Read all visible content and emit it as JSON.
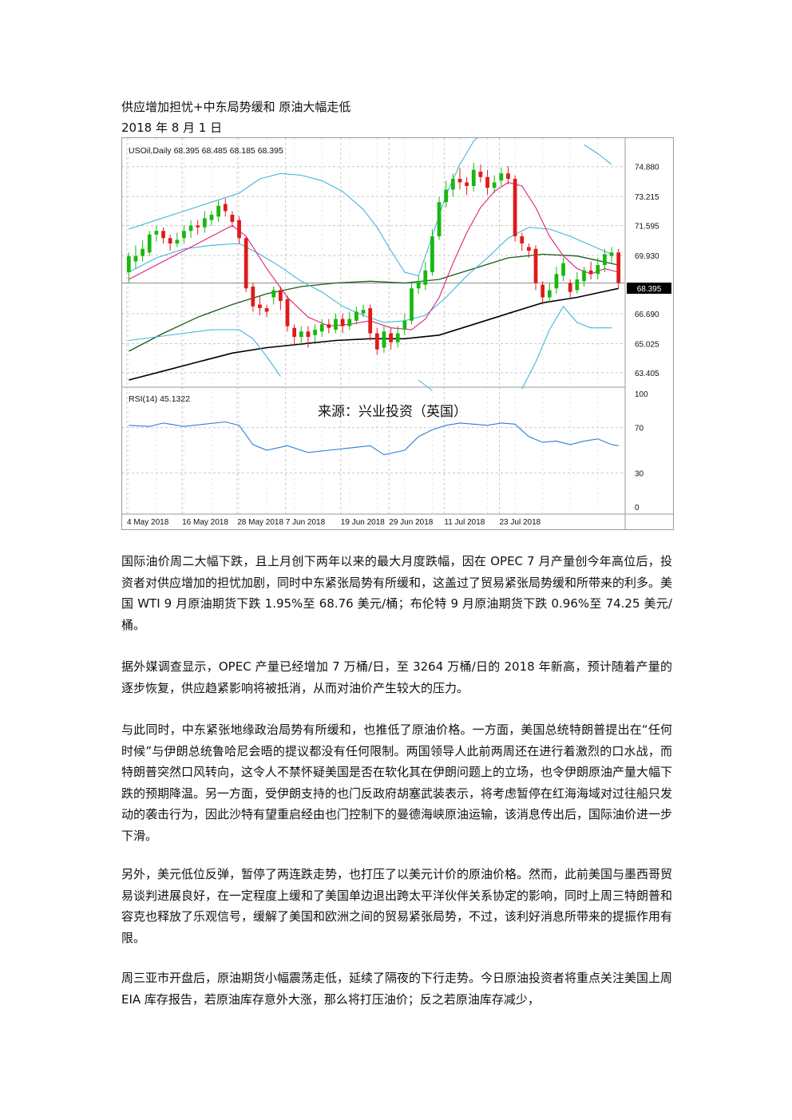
{
  "doc": {
    "title": "供应增加担忧+中东局势缓和  原油大幅走低",
    "date": "2018 年 8 月 1 日"
  },
  "chart": {
    "header": "USOil,Daily  68.395 68.485 68.185 68.395",
    "current_price_label": "68.395",
    "rsi_label": "RSI(14) 45.1322",
    "source_note": "来源：兴业投资（英国）",
    "price_ticks": [
      "74.880",
      "73.215",
      "71.595",
      "69.930",
      "66.690",
      "65.025",
      "63.405"
    ],
    "rsi_ticks": [
      "100",
      "70",
      "30",
      "0"
    ],
    "date_ticks": [
      "4 May 2018",
      "16 May 2018",
      "28 May 2018",
      "7 Jun 2018",
      "19 Jun 2018",
      "29 Jun 2018",
      "11 Jul 2018",
      "23 Jul 2018"
    ],
    "colors": {
      "up": "#18b80f",
      "down": "#e01a1a",
      "bollinger": "#3fb8d6",
      "ma_pink": "#e0207f",
      "ma_green": "#1c5a1c",
      "ma_black": "#000000",
      "rsi": "#2a7fd4"
    }
  },
  "chart_data": {
    "type": "candlestick",
    "title": "USOil,Daily",
    "price_range": [
      62.6,
      76.2
    ],
    "rsi_range": [
      0,
      100
    ],
    "rsi_last": 45.1322,
    "last_price": 68.395,
    "candles": [
      [
        69.0,
        69.9,
        70.1,
        68.4
      ],
      [
        69.6,
        69.9,
        70.5,
        69.2
      ],
      [
        69.9,
        70.3,
        70.8,
        69.6
      ],
      [
        70.1,
        71.1,
        71.3,
        69.9
      ],
      [
        71.1,
        71.3,
        71.6,
        70.7
      ],
      [
        71.3,
        70.9,
        71.5,
        70.6
      ],
      [
        70.9,
        70.6,
        71.1,
        70.2
      ],
      [
        70.6,
        70.8,
        71.2,
        70.4
      ],
      [
        70.9,
        71.3,
        71.6,
        70.6
      ],
      [
        71.3,
        71.6,
        71.9,
        70.9
      ],
      [
        71.6,
        71.5,
        71.9,
        71.1
      ],
      [
        71.5,
        72.0,
        72.4,
        71.2
      ],
      [
        71.9,
        72.2,
        72.4,
        71.6
      ],
      [
        72.1,
        72.7,
        73.0,
        71.8
      ],
      [
        72.8,
        72.4,
        73.1,
        72.1
      ],
      [
        72.2,
        71.8,
        72.4,
        71.5
      ],
      [
        71.9,
        70.9,
        72.1,
        70.6
      ],
      [
        70.9,
        68.1,
        71.0,
        67.9
      ],
      [
        68.2,
        67.1,
        68.4,
        66.8
      ],
      [
        67.2,
        67.0,
        67.7,
        66.6
      ],
      [
        67.0,
        66.8,
        67.2,
        66.5
      ],
      [
        67.6,
        68.0,
        68.2,
        67.2
      ],
      [
        68.0,
        67.4,
        68.2,
        66.9
      ],
      [
        67.5,
        66.0,
        67.7,
        65.7
      ],
      [
        65.9,
        65.4,
        66.1,
        64.9
      ],
      [
        65.4,
        65.7,
        66.0,
        64.9
      ],
      [
        65.7,
        65.4,
        66.0,
        64.8
      ],
      [
        65.5,
        65.8,
        66.1,
        65.1
      ],
      [
        65.7,
        66.1,
        66.4,
        65.4
      ],
      [
        66.1,
        65.9,
        66.4,
        65.6
      ],
      [
        65.8,
        66.4,
        66.7,
        65.6
      ],
      [
        66.4,
        66.0,
        66.7,
        65.6
      ],
      [
        66.0,
        66.4,
        66.8,
        65.8
      ],
      [
        66.3,
        66.8,
        67.1,
        66.1
      ],
      [
        66.7,
        66.9,
        67.2,
        66.5
      ],
      [
        67.0,
        65.6,
        67.2,
        65.2
      ],
      [
        65.6,
        64.7,
        65.9,
        64.4
      ],
      [
        64.8,
        65.7,
        66.0,
        64.5
      ],
      [
        65.6,
        65.1,
        65.9,
        64.7
      ],
      [
        65.1,
        65.6,
        66.0,
        64.8
      ],
      [
        65.8,
        66.3,
        66.7,
        65.5
      ],
      [
        66.3,
        68.1,
        68.4,
        66.1
      ],
      [
        68.1,
        68.5,
        68.8,
        67.8
      ],
      [
        68.3,
        69.1,
        69.6,
        68.0
      ],
      [
        69.0,
        71.0,
        71.4,
        68.8
      ],
      [
        71.0,
        72.9,
        73.2,
        70.8
      ],
      [
        72.9,
        73.6,
        74.1,
        72.6
      ],
      [
        73.6,
        74.2,
        74.5,
        73.2
      ],
      [
        74.2,
        74.0,
        74.8,
        73.6
      ],
      [
        74.0,
        73.8,
        74.3,
        73.3
      ],
      [
        73.8,
        74.7,
        75.1,
        73.5
      ],
      [
        74.6,
        74.3,
        75.0,
        74.0
      ],
      [
        74.3,
        73.7,
        74.7,
        73.3
      ],
      [
        73.7,
        74.0,
        74.4,
        73.4
      ],
      [
        74.1,
        74.5,
        74.8,
        73.8
      ],
      [
        74.5,
        74.2,
        74.9,
        73.9
      ],
      [
        74.2,
        71.0,
        74.4,
        70.7
      ],
      [
        71.0,
        70.6,
        71.2,
        70.2
      ],
      [
        70.4,
        70.2,
        70.6,
        69.8
      ],
      [
        70.3,
        68.4,
        70.5,
        68.0
      ],
      [
        68.3,
        67.6,
        68.5,
        67.2
      ],
      [
        67.6,
        68.0,
        68.4,
        67.3
      ],
      [
        68.1,
        68.9,
        69.3,
        67.8
      ],
      [
        68.8,
        69.5,
        69.8,
        68.5
      ],
      [
        68.4,
        67.9,
        68.6,
        67.6
      ],
      [
        68.0,
        68.6,
        69.0,
        67.8
      ],
      [
        68.5,
        69.1,
        69.3,
        68.2
      ],
      [
        69.1,
        68.9,
        69.6,
        68.6
      ],
      [
        68.9,
        69.4,
        69.8,
        68.6
      ],
      [
        69.4,
        70.0,
        70.3,
        69.0
      ],
      [
        69.9,
        70.1,
        70.4,
        69.5
      ],
      [
        70.1,
        68.4,
        70.3,
        68.1
      ]
    ],
    "bollinger_upper": [
      [
        0,
        71.4
      ],
      [
        4,
        71.9
      ],
      [
        8,
        72.4
      ],
      [
        12,
        72.9
      ],
      [
        16,
        73.4
      ],
      [
        19,
        74.2
      ],
      [
        22,
        74.5
      ],
      [
        25,
        74.4
      ],
      [
        28,
        74.1
      ],
      [
        31,
        73.5
      ],
      [
        34,
        72.5
      ],
      [
        36,
        71.5
      ],
      [
        38,
        70.2
      ],
      [
        40,
        69.0
      ],
      [
        42,
        68.8
      ],
      [
        44,
        71.0
      ],
      [
        46,
        73.3
      ],
      [
        48,
        75.0
      ],
      [
        50,
        76.3
      ],
      [
        52,
        77.0
      ]
    ],
    "bollinger_upper_tail": [
      [
        66,
        76.1
      ],
      [
        68,
        75.6
      ],
      [
        70,
        75.0
      ]
    ],
    "bollinger_middle": [
      [
        0,
        69.0
      ],
      [
        4,
        69.8
      ],
      [
        8,
        70.3
      ],
      [
        12,
        70.5
      ],
      [
        16,
        70.6
      ],
      [
        19,
        70.0
      ],
      [
        22,
        69.3
      ],
      [
        25,
        68.5
      ],
      [
        28,
        67.9
      ],
      [
        31,
        67.1
      ],
      [
        34,
        66.6
      ],
      [
        37,
        66.2
      ],
      [
        40,
        66.3
      ],
      [
        43,
        66.6
      ],
      [
        46,
        67.6
      ],
      [
        49,
        68.8
      ],
      [
        52,
        69.8
      ],
      [
        55,
        70.9
      ],
      [
        58,
        71.5
      ],
      [
        61,
        71.4
      ],
      [
        64,
        71.0
      ],
      [
        67,
        70.5
      ],
      [
        70,
        70.0
      ]
    ],
    "bollinger_lower": [
      [
        0,
        65.2
      ],
      [
        4,
        65.4
      ],
      [
        8,
        65.6
      ],
      [
        12,
        65.8
      ],
      [
        16,
        65.8
      ],
      [
        18,
        65.3
      ],
      [
        20,
        64.3
      ],
      [
        22,
        63.2
      ]
    ],
    "bollinger_lower_2": [
      [
        42,
        63.0
      ],
      [
        44,
        62.4
      ]
    ],
    "bollinger_lower_3": [
      [
        57,
        62.5
      ],
      [
        59,
        64.0
      ],
      [
        61,
        65.8
      ],
      [
        63,
        67.1
      ],
      [
        65,
        66.2
      ],
      [
        67,
        65.9
      ],
      [
        70,
        65.9
      ]
    ],
    "ma_pink": [
      [
        0,
        68.6
      ],
      [
        4,
        69.4
      ],
      [
        8,
        70.2
      ],
      [
        12,
        71.0
      ],
      [
        15,
        71.6
      ],
      [
        17,
        71.0
      ],
      [
        20,
        69.2
      ],
      [
        23,
        67.6
      ],
      [
        26,
        66.5
      ],
      [
        29,
        66.0
      ],
      [
        32,
        66.1
      ],
      [
        35,
        66.3
      ],
      [
        38,
        65.9
      ],
      [
        41,
        65.8
      ],
      [
        43,
        66.4
      ],
      [
        45,
        67.6
      ],
      [
        47,
        69.5
      ],
      [
        49,
        71.2
      ],
      [
        51,
        72.6
      ],
      [
        53,
        73.5
      ],
      [
        55,
        74.0
      ],
      [
        57,
        73.8
      ],
      [
        59,
        72.6
      ],
      [
        61,
        71.0
      ],
      [
        63,
        69.9
      ],
      [
        65,
        69.2
      ],
      [
        67,
        68.9
      ],
      [
        69,
        69.2
      ],
      [
        71,
        69.0
      ]
    ],
    "ma_green": [
      [
        0,
        64.6
      ],
      [
        5,
        65.6
      ],
      [
        10,
        66.5
      ],
      [
        15,
        67.2
      ],
      [
        20,
        67.8
      ],
      [
        25,
        68.2
      ],
      [
        30,
        68.4
      ],
      [
        35,
        68.5
      ],
      [
        40,
        68.4
      ],
      [
        45,
        68.6
      ],
      [
        50,
        69.2
      ],
      [
        55,
        69.8
      ],
      [
        60,
        70.0
      ],
      [
        65,
        69.9
      ],
      [
        71,
        69.4
      ]
    ],
    "ma_black": [
      [
        0,
        63.0
      ],
      [
        5,
        63.5
      ],
      [
        10,
        64.0
      ],
      [
        15,
        64.5
      ],
      [
        20,
        64.8
      ],
      [
        25,
        65.0
      ],
      [
        30,
        65.2
      ],
      [
        35,
        65.3
      ],
      [
        40,
        65.3
      ],
      [
        45,
        65.5
      ],
      [
        50,
        66.1
      ],
      [
        55,
        66.7
      ],
      [
        60,
        67.3
      ],
      [
        65,
        67.6
      ],
      [
        71,
        68.1
      ]
    ],
    "rsi": [
      [
        0,
        72
      ],
      [
        3,
        71
      ],
      [
        5,
        74
      ],
      [
        8,
        71
      ],
      [
        11,
        73
      ],
      [
        14,
        75
      ],
      [
        16,
        72
      ],
      [
        18,
        55
      ],
      [
        20,
        50
      ],
      [
        23,
        54
      ],
      [
        26,
        48
      ],
      [
        29,
        50
      ],
      [
        32,
        52
      ],
      [
        35,
        54
      ],
      [
        37,
        46
      ],
      [
        40,
        50
      ],
      [
        42,
        62
      ],
      [
        44,
        68
      ],
      [
        46,
        72
      ],
      [
        48,
        74
      ],
      [
        50,
        73
      ],
      [
        52,
        72
      ],
      [
        54,
        74
      ],
      [
        56,
        73
      ],
      [
        58,
        62
      ],
      [
        60,
        57
      ],
      [
        62,
        58
      ],
      [
        64,
        55
      ],
      [
        66,
        58
      ],
      [
        68,
        60
      ],
      [
        70,
        55
      ],
      [
        71,
        54
      ]
    ]
  },
  "paragraphs": [
    "国际油价周二大幅下跌，且上月创下两年以来的最大月度跌幅，因在 OPEC 7 月产量创今年高位后，投资者对供应增加的担忧加剧，同时中东紧张局势有所缓和，这盖过了贸易紧张局势缓和所带来的利多。美国 WTI 9 月原油期货下跌 1.95%至 68.76 美元/桶；布伦特 9 月原油期货下跌 0.96%至 74.25 美元/桶。",
    "据外媒调查显示，OPEC 产量已经增加 7 万桶/日，至 3264 万桶/日的 2018 年新高，预计随着产量的逐步恢复，供应趋紧影响将被抵消，从而对油价产生较大的压力。",
    "与此同时，中东紧张地缘政治局势有所缓和，也推低了原油价格。一方面，美国总统特朗普提出在“任何时候”与伊朗总统鲁哈尼会晤的提议都没有任何限制。两国领导人此前两周还在进行着激烈的口水战，而特朗普突然口风转向，这令人不禁怀疑美国是否在软化其在伊朗问题上的立场，也令伊朗原油产量大幅下跌的预期降温。另一方面，受伊朗支持的也门反政府胡塞武装表示，将考虑暂停在红海海域对过往船只发动的袭击行为，因此沙特有望重启经由也门控制下的曼德海峡原油运输，该消息传出后，国际油价进一步下滑。",
    "另外，美元低位反弹，暂停了两连跌走势，也打压了以美元计价的原油价格。然而，此前美国与墨西哥贸易谈判进展良好，在一定程度上缓和了美国单边退出跨太平洋伙伴关系协定的影响，同时上周三特朗普和容克也释放了乐观信号，缓解了美国和欧洲之间的贸易紧张局势，不过，该利好消息所带来的提振作用有限。",
    "周三亚市开盘后，原油期货小幅震荡走低，延续了隔夜的下行走势。今日原油投资者将重点关注美国上周 EIA 库存报告，若原油库存意外大涨，那么将打压油价；反之若原油库存减少，"
  ]
}
